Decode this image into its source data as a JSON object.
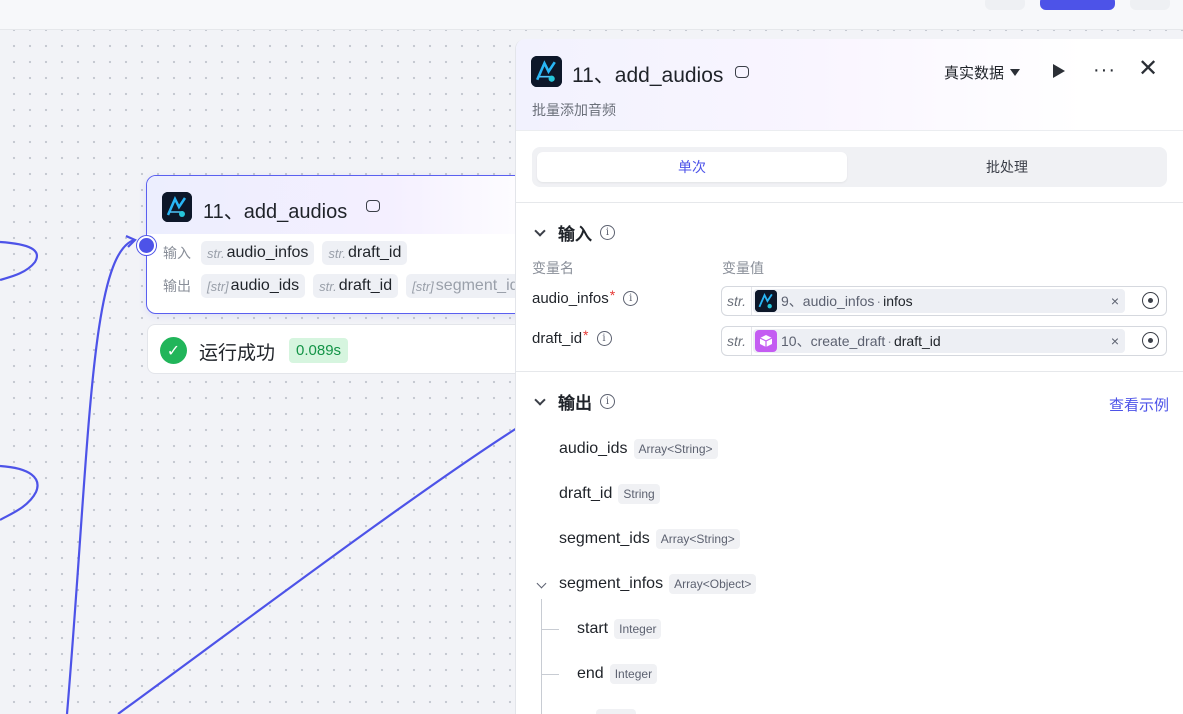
{
  "node": {
    "title": "11、add_audios",
    "input_label": "输入",
    "output_label": "输出",
    "inputs": [
      {
        "type": "str.",
        "name": "audio_infos"
      },
      {
        "type": "str.",
        "name": "draft_id"
      }
    ],
    "outputs": [
      {
        "type": "[str]",
        "name": "audio_ids"
      },
      {
        "type": "str.",
        "name": "draft_id"
      },
      {
        "type": "[str]",
        "name": "segment_id"
      }
    ]
  },
  "run_status": {
    "text": "运行成功",
    "time": "0.089s"
  },
  "panel": {
    "title": "11、add_audios",
    "subtitle": "批量添加音频",
    "data_source": "真实数据",
    "tabs": [
      "单次",
      "批处理"
    ],
    "input_section": {
      "title": "输入",
      "col_name": "变量名",
      "col_value": "变量值",
      "vars": [
        {
          "name": "audio_infos",
          "type": "str.",
          "ref_node": "9、audio_infos",
          "ref_field": "infos"
        },
        {
          "name": "draft_id",
          "type": "str.",
          "ref_node": "10、create_draft",
          "ref_field": "draft_id"
        }
      ]
    },
    "output_section": {
      "title": "输出",
      "example_link": "查看示例",
      "fields": [
        {
          "name": "audio_ids",
          "type": "Array<String>"
        },
        {
          "name": "draft_id",
          "type": "String"
        },
        {
          "name": "segment_ids",
          "type": "Array<String>"
        },
        {
          "name": "segment_infos",
          "type": "Array<Object>"
        }
      ],
      "children": [
        {
          "name": "start",
          "type": "Integer"
        },
        {
          "name": "end",
          "type": "Integer"
        }
      ]
    }
  },
  "icons": {
    "node": "plugin-logo-icon",
    "ref_9": "plugin-logo-icon",
    "ref_10": "cube-icon",
    "run_ok": "check-circle-icon"
  },
  "colors": {
    "accent": "#4d53e8",
    "success": "#21b55a",
    "success_bg": "#d6f5df",
    "required": "#e53935",
    "cube": "#c45cf2"
  }
}
